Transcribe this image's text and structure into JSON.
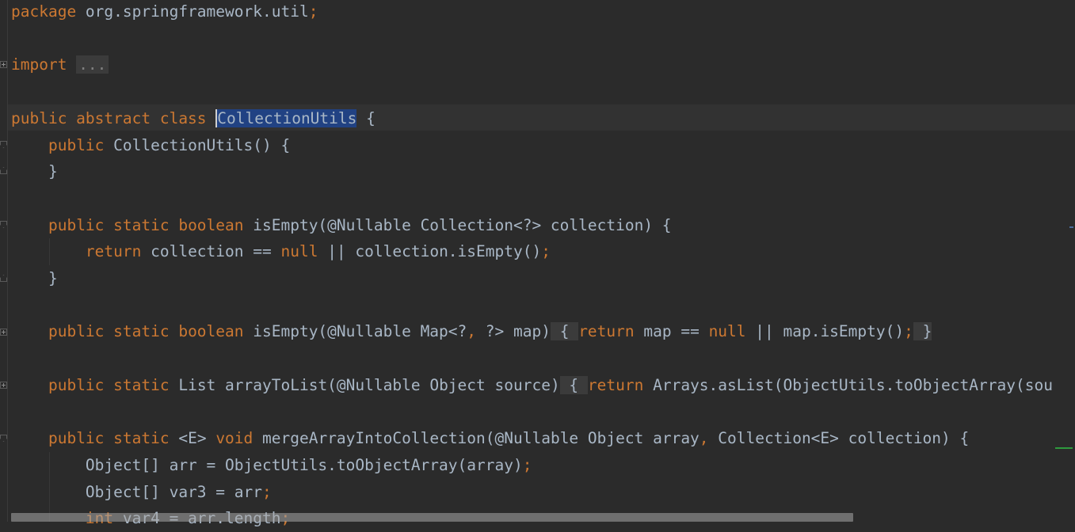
{
  "editor": {
    "lines": [
      [
        {
          "t": "kw",
          "s": "package "
        },
        {
          "t": "id",
          "s": "org.springframework.util"
        },
        {
          "t": "semi",
          "s": ";"
        }
      ],
      [],
      [
        {
          "t": "kw",
          "s": "import "
        },
        {
          "t": "ellipsis",
          "s": "..."
        }
      ],
      [],
      [
        {
          "t": "kw",
          "s": "public abstract class "
        },
        {
          "t": "sel",
          "s": "CollectionUtils"
        },
        {
          "t": "id",
          "s": " {"
        }
      ],
      [
        {
          "t": "id",
          "s": "    "
        },
        {
          "t": "kw",
          "s": "public "
        },
        {
          "t": "id",
          "s": "CollectionUtils() {"
        }
      ],
      [
        {
          "t": "id",
          "s": "    }"
        }
      ],
      [],
      [
        {
          "t": "id",
          "s": "    "
        },
        {
          "t": "kw",
          "s": "public static boolean "
        },
        {
          "t": "id",
          "s": "isEmpty(@Nullable Collection<?> collection) {"
        }
      ],
      [
        {
          "t": "id",
          "s": "        "
        },
        {
          "t": "kw",
          "s": "return "
        },
        {
          "t": "id",
          "s": "collection == "
        },
        {
          "t": "kw",
          "s": "null "
        },
        {
          "t": "id",
          "s": "|| collection.isEmpty()"
        },
        {
          "t": "semi",
          "s": ";"
        }
      ],
      [
        {
          "t": "id",
          "s": "    }"
        }
      ],
      [],
      [
        {
          "t": "id",
          "s": "    "
        },
        {
          "t": "kw",
          "s": "public static boolean "
        },
        {
          "t": "id",
          "s": "isEmpty(@Nullable Map<?"
        },
        {
          "t": "semi",
          "s": ", "
        },
        {
          "t": "id",
          "s": "?> map)"
        },
        {
          "t": "fold",
          "s": " { "
        },
        {
          "t": "kw",
          "s": "return "
        },
        {
          "t": "id",
          "s": "map == "
        },
        {
          "t": "kw",
          "s": "null "
        },
        {
          "t": "id",
          "s": "|| map.isEmpty()"
        },
        {
          "t": "semi",
          "s": ";"
        },
        {
          "t": "fold",
          "s": " }"
        }
      ],
      [],
      [
        {
          "t": "id",
          "s": "    "
        },
        {
          "t": "kw",
          "s": "public static "
        },
        {
          "t": "id",
          "s": "List arrayToList(@Nullable Object source)"
        },
        {
          "t": "fold",
          "s": " { "
        },
        {
          "t": "kw",
          "s": "return "
        },
        {
          "t": "id",
          "s": "Arrays.asList(ObjectUtils.toObjectArray(sou"
        }
      ],
      [],
      [
        {
          "t": "id",
          "s": "    "
        },
        {
          "t": "kw",
          "s": "public static "
        },
        {
          "t": "id",
          "s": "<E> "
        },
        {
          "t": "kw",
          "s": "void "
        },
        {
          "t": "id",
          "s": "mergeArrayIntoCollection(@Nullable Object array"
        },
        {
          "t": "semi",
          "s": ", "
        },
        {
          "t": "id",
          "s": "Collection<E> collection) {"
        }
      ],
      [
        {
          "t": "id",
          "s": "        Object[] arr = ObjectUtils.toObjectArray(array)"
        },
        {
          "t": "semi",
          "s": ";"
        }
      ],
      [
        {
          "t": "id",
          "s": "        Object[] var3 = arr"
        },
        {
          "t": "semi",
          "s": ";"
        }
      ],
      [
        {
          "t": "id",
          "s": "        "
        },
        {
          "t": "kw",
          "s": "int "
        },
        {
          "t": "id",
          "s": "var4 = arr.length"
        },
        {
          "t": "semi",
          "s": ";"
        }
      ]
    ]
  },
  "colors": {
    "background": "#2b2b2b",
    "keyword": "#cc7832",
    "identifier": "#a9b7c6",
    "selection": "#214283",
    "current_line": "#323232"
  },
  "gutter_icons": [
    "fold-collapsed-icon",
    "fold-open-icon",
    "fold-close-icon"
  ]
}
